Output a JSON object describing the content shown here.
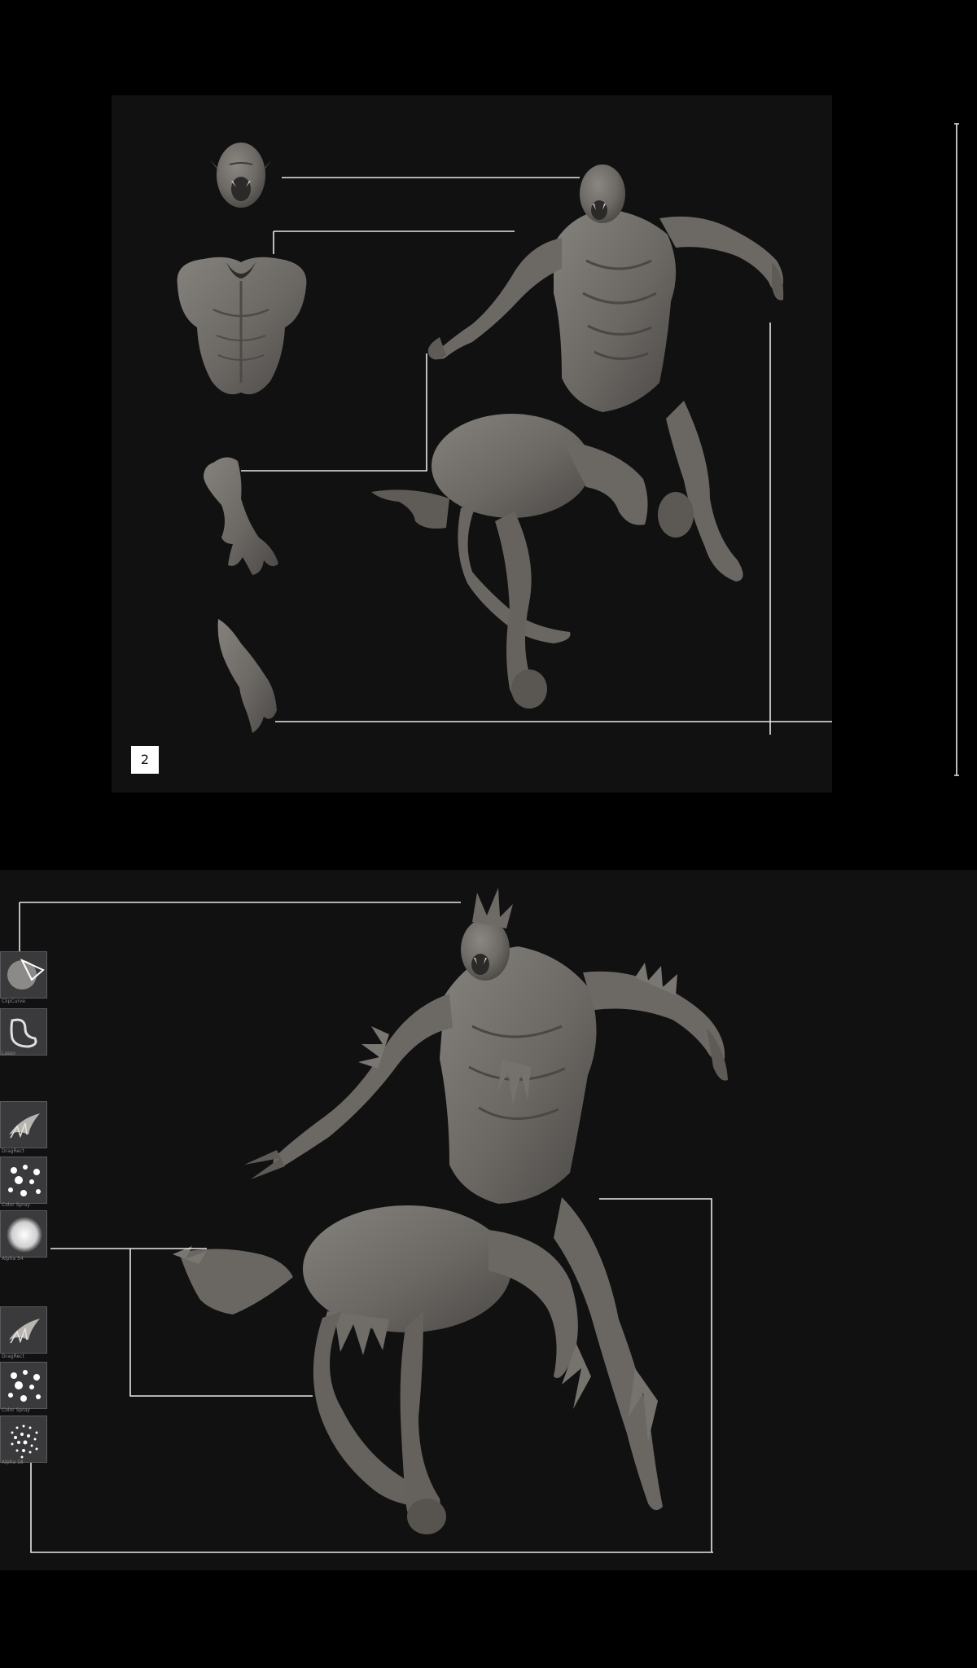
{
  "step_badge": "2",
  "tool_palette": [
    {
      "icon": "clipcurve-brush-icon",
      "label": "ClipCurve"
    },
    {
      "icon": "lasso-stroke-icon",
      "label": "Lasso"
    },
    {
      "icon": "dragrect-brush-icon",
      "label": "DragRect"
    },
    {
      "icon": "color-spray-stroke-icon",
      "label": "Color Spray"
    },
    {
      "icon": "alpha-icon",
      "label": "Alpha 54"
    },
    {
      "icon": "dragrect-brush-icon",
      "label": "DragRect"
    },
    {
      "icon": "color-spray-stroke-icon",
      "label": "Color Spray"
    },
    {
      "icon": "alpha-icon",
      "label": "Alpha 18"
    }
  ],
  "colors": {
    "page_background": "#000000",
    "panel_background": "#111112",
    "clay": "#6d6a66",
    "clay_shadow": "#4e4b48",
    "guide_line": "#e8e8e8"
  }
}
